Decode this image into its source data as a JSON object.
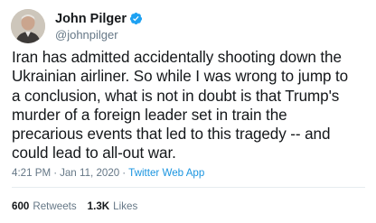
{
  "author": {
    "display_name": "John Pilger",
    "handle": "@johnpilger",
    "verified": true,
    "avatar_icon": "user-avatar-icon",
    "verified_color": "#1da1f2"
  },
  "tweet": {
    "text_lines": [
      "Iran has admitted accidentally shooting down the",
      "Ukrainian airliner. So while I was wrong to jump to",
      "a conclusion, what is not in doubt is that Trump's",
      "murder of a foreign leader set in train the",
      "precarious events that led to this tragedy -- and",
      "could lead to all-out war."
    ]
  },
  "meta": {
    "time": "4:21 PM",
    "separator": "·",
    "date": "Jan 11, 2020",
    "source": "Twitter Web App"
  },
  "stats": {
    "retweets_count": "600",
    "retweets_label": "Retweets",
    "likes_count": "1.3K",
    "likes_label": "Likes"
  },
  "colors": {
    "text": "#14171a",
    "secondary": "#657786",
    "link": "#1b95e0",
    "divider": "#e6ecf0"
  }
}
